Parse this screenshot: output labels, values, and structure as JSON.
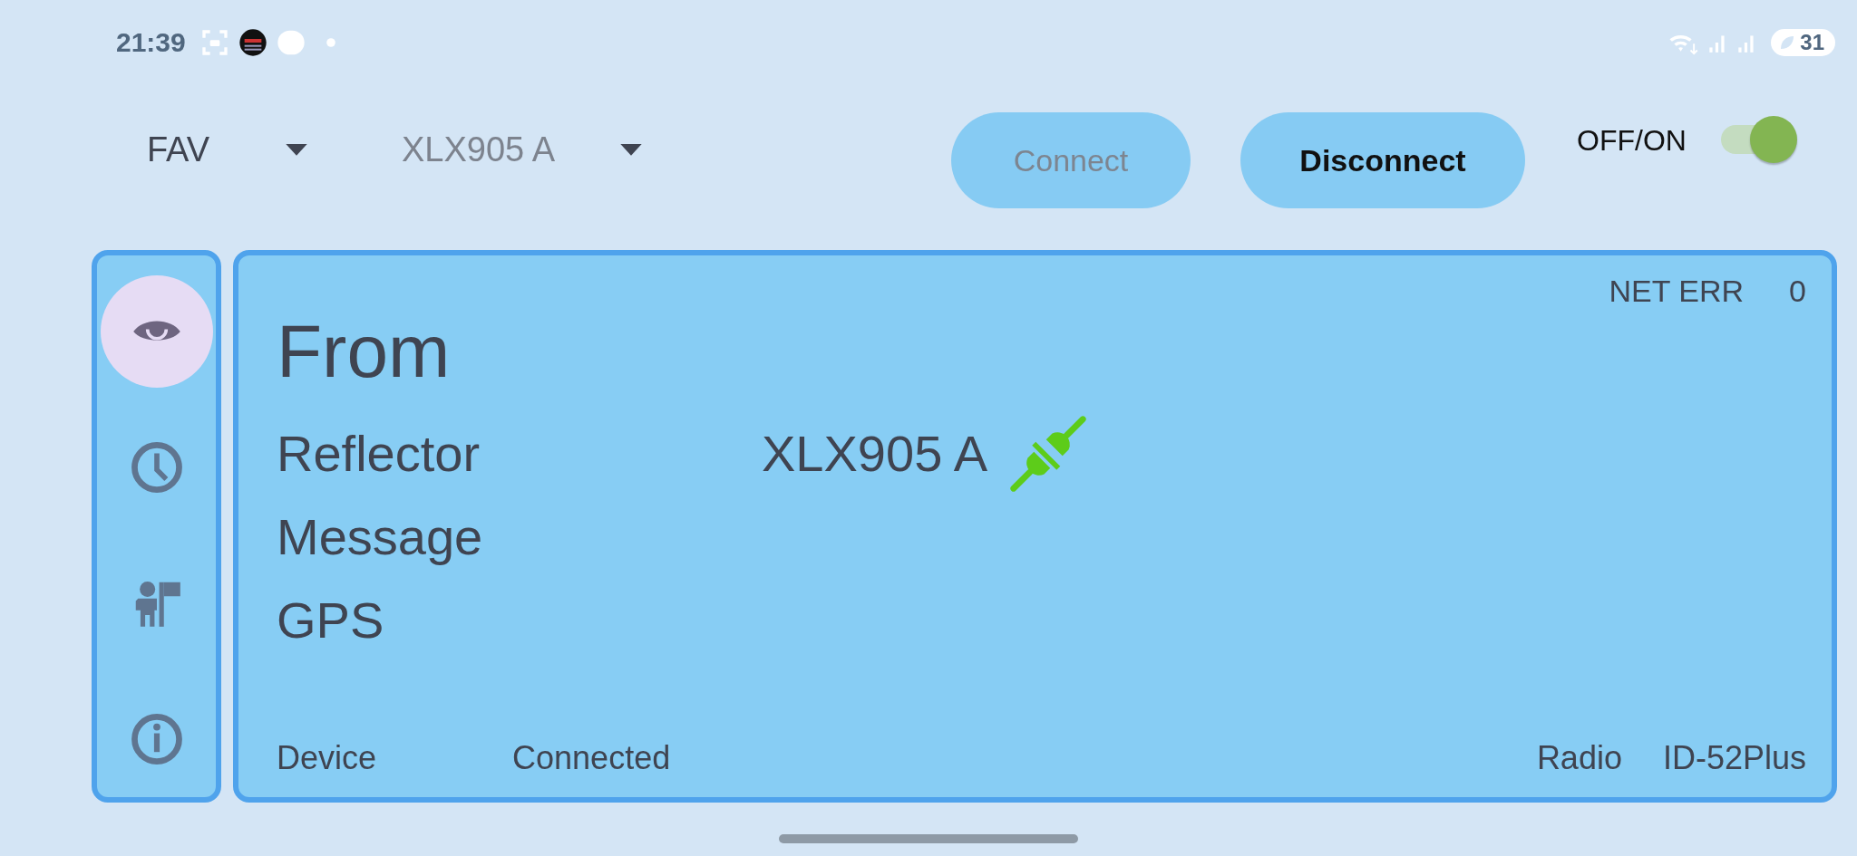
{
  "status_bar": {
    "time": "21:39",
    "battery": "31"
  },
  "toolbar": {
    "dropdowns": [
      {
        "label": "FAV",
        "disabled": false
      },
      {
        "label": "XLX905 A",
        "disabled": true
      }
    ],
    "buttons": [
      {
        "label": "Connect",
        "disabled": true
      },
      {
        "label": "Disconnect",
        "disabled": false
      }
    ],
    "switch": {
      "label": "OFF/ON",
      "on": true
    }
  },
  "sidebar": {
    "items": [
      {
        "kind": "eye",
        "selected": true
      },
      {
        "kind": "clock",
        "selected": false
      },
      {
        "kind": "person",
        "selected": false
      },
      {
        "kind": "info",
        "selected": false
      }
    ]
  },
  "panel": {
    "net_err": {
      "label": "NET ERR",
      "value": "0"
    },
    "title": "From",
    "rows": [
      {
        "label": "Reflector",
        "value": "XLX905 A",
        "linked": true
      },
      {
        "label": "Message"
      },
      {
        "label": "GPS"
      }
    ],
    "footer": {
      "device_label": "Device",
      "device_status": "Connected",
      "radio_label": "Radio",
      "radio_value": "ID-52Plus"
    }
  }
}
